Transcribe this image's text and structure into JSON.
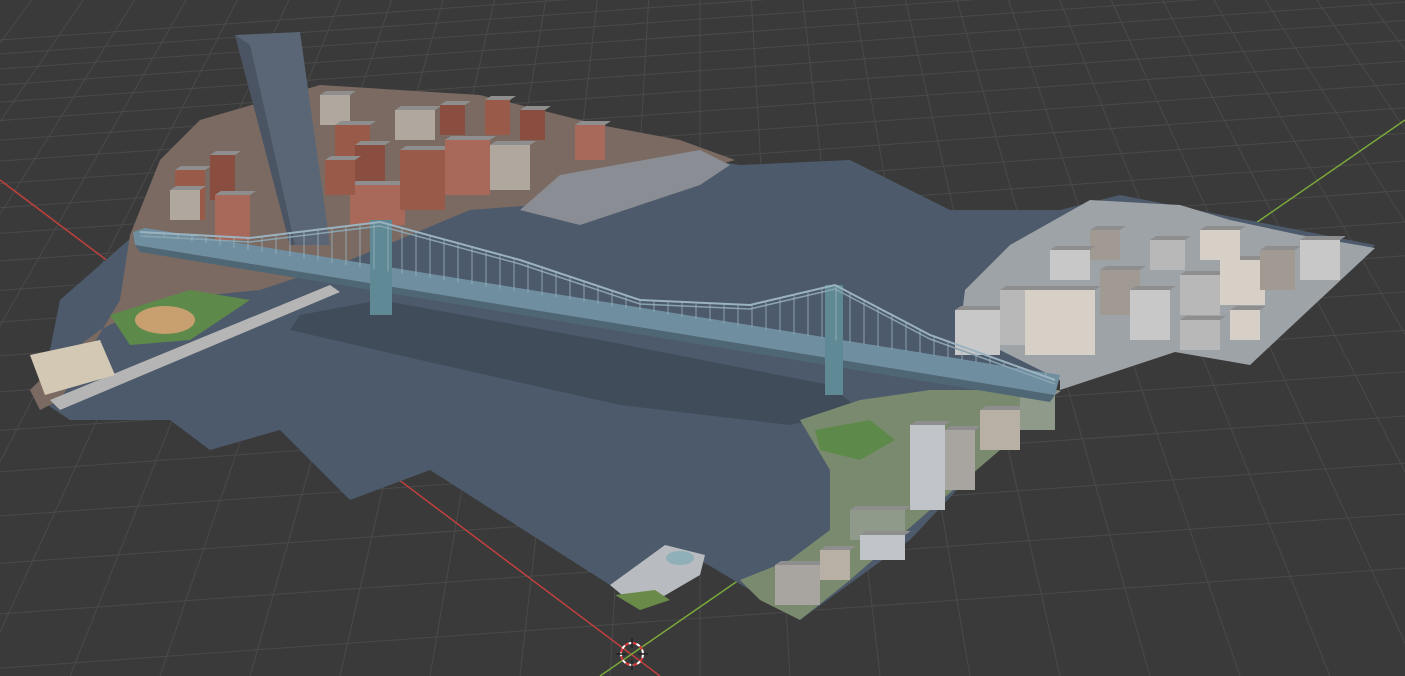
{
  "viewport": {
    "background_color": "#3a3a3a",
    "grid_color": "#4a4a4a",
    "x_axis_color": "#c0403e",
    "y_axis_color": "#7aa83a"
  },
  "scene": {
    "object": "3d-city-tile-mesh",
    "water_color": "#4d5a6b",
    "water_dark_color": "#3f4a58",
    "bridge_color": "#6f8fa0",
    "bridge_tower_color": "#5f8a95",
    "building_brick_color": "#9a5a4a",
    "building_light_color": "#c8c8c8",
    "park_color": "#5d8a4a"
  },
  "gizmo": {
    "name": "3d-cursor",
    "color_a": "#e03a3a",
    "color_b": "#ffffff"
  }
}
